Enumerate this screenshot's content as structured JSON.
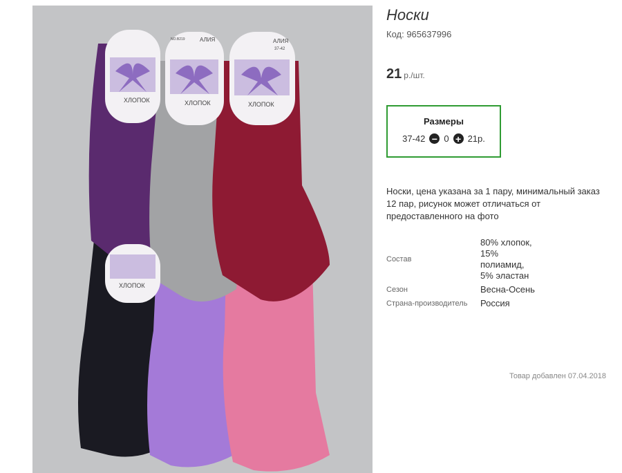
{
  "product": {
    "title": "Носки",
    "code": "Код: 965637996",
    "price": "21",
    "price_unit": "р./шт."
  },
  "sizes": {
    "heading": "Размеры",
    "size": "37-42",
    "quantity": "0",
    "size_price": "21р."
  },
  "description": "Носки, цена указана за 1 пару, минимальный заказ 12 пар, рисунок может отличаться от предоставленного на фото",
  "properties": [
    {
      "key": "Состав",
      "value": "80% хлопок, 15% полиамид, 5% эластан"
    },
    {
      "key": "Сезон",
      "value": "Весна-Осень"
    },
    {
      "key": "Страна-производитель",
      "value": "Россия"
    }
  ],
  "added": "Товар добавлен 07.04.2018",
  "photo": {
    "label_brand": "АЛИЯ",
    "label_size": "37-42",
    "label_material": "ХЛОПОК",
    "label_no": "NO.B219",
    "sock_colors": [
      "#5a2a6e",
      "#a2a3a5",
      "#8e1a33",
      "#1a1a22",
      "#a47ad8",
      "#e57aa0"
    ]
  }
}
